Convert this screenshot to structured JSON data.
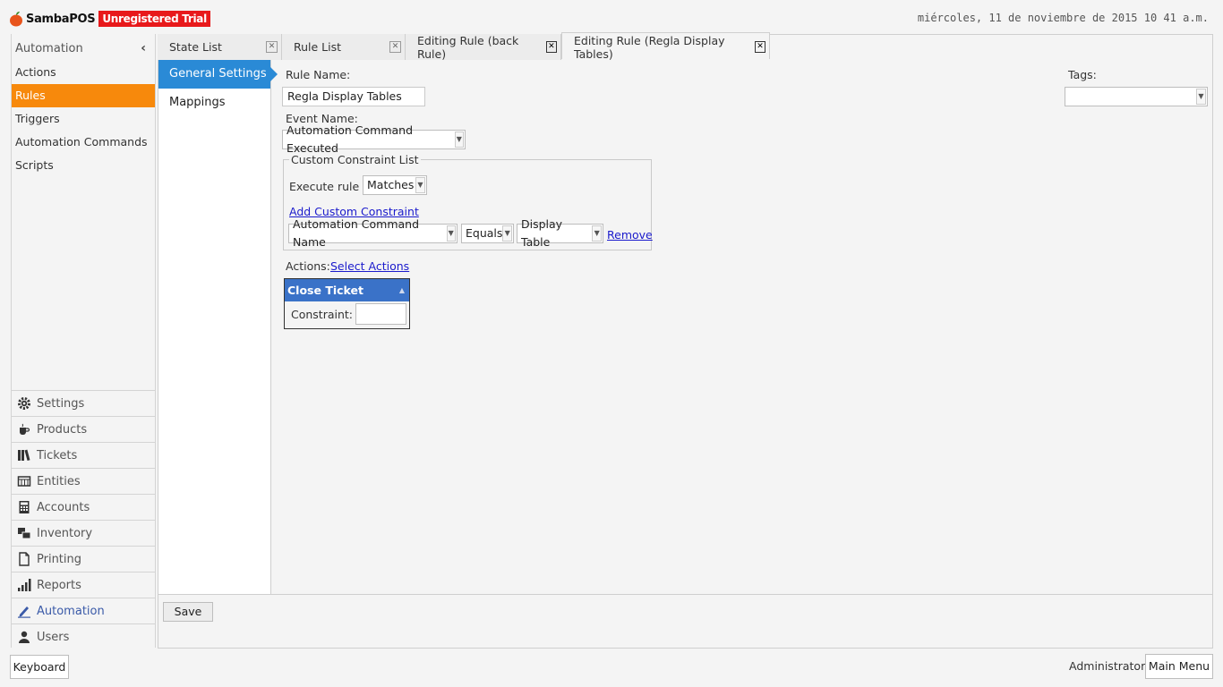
{
  "header": {
    "brand": "SambaPOS",
    "trial_badge": "Unregistered Trial",
    "datetime": "miércoles, 11 de noviembre de 2015 10 41 a.m."
  },
  "sidebar": {
    "section_title": "Automation",
    "collapse_glyph": "‹",
    "items": [
      {
        "label": "Actions",
        "active": false
      },
      {
        "label": "Rules",
        "active": true
      },
      {
        "label": "Triggers",
        "active": false
      },
      {
        "label": "Automation Commands",
        "active": false
      },
      {
        "label": "Scripts",
        "active": false
      }
    ],
    "categories": [
      {
        "label": "Settings",
        "icon": "gear-icon"
      },
      {
        "label": "Products",
        "icon": "coffee-cup-icon"
      },
      {
        "label": "Tickets",
        "icon": "books-icon"
      },
      {
        "label": "Entities",
        "icon": "table-icon"
      },
      {
        "label": "Accounts",
        "icon": "calculator-icon"
      },
      {
        "label": "Inventory",
        "icon": "boxes-icon"
      },
      {
        "label": "Printing",
        "icon": "document-icon"
      },
      {
        "label": "Reports",
        "icon": "bar-chart-icon"
      },
      {
        "label": "Automation",
        "icon": "pencil-icon",
        "active": true
      },
      {
        "label": "Users",
        "icon": "user-icon"
      }
    ]
  },
  "tabs": [
    {
      "label": "State List",
      "close": "✕"
    },
    {
      "label": "Rule List",
      "close": "✕"
    },
    {
      "label": "Editing Rule (back Rule)",
      "close": "✕"
    },
    {
      "label": "Editing Rule (Regla Display Tables)",
      "close": "✕",
      "active": true
    }
  ],
  "subnav": {
    "items": [
      {
        "label": "General Settings",
        "active": true
      },
      {
        "label": "Mappings",
        "active": false
      }
    ]
  },
  "form": {
    "rule_name_label": "Rule Name:",
    "rule_name_value": "Regla Display Tables",
    "event_name_label": "Event Name:",
    "event_name_value": "Automation Command Executed",
    "tags_label": "Tags:",
    "tags_value": "",
    "constraint_legend": "Custom Constraint List",
    "execute_rule_label": "Execute rule if",
    "execute_rule_value": "Matches",
    "add_constraint_link": "Add Custom Constraint",
    "constraint_row": {
      "field": "Automation Command Name",
      "operator": "Equals",
      "value": "Display Table",
      "remove_link": "Remove"
    },
    "actions_label": "Actions:",
    "select_actions_link": "Select Actions",
    "action_card": {
      "title": "Close Ticket",
      "constraint_label": "Constraint:",
      "constraint_value": ""
    }
  },
  "footer": {
    "save_label": "Save",
    "keyboard_label": "Keyboard",
    "user_label": "Administrator",
    "main_menu_label": "Main Menu"
  },
  "colors": {
    "accent_orange": "#f7890c",
    "selected_blue": "#2a8ad6",
    "card_header_blue": "#3a72c8",
    "trial_red": "#e8191b"
  }
}
